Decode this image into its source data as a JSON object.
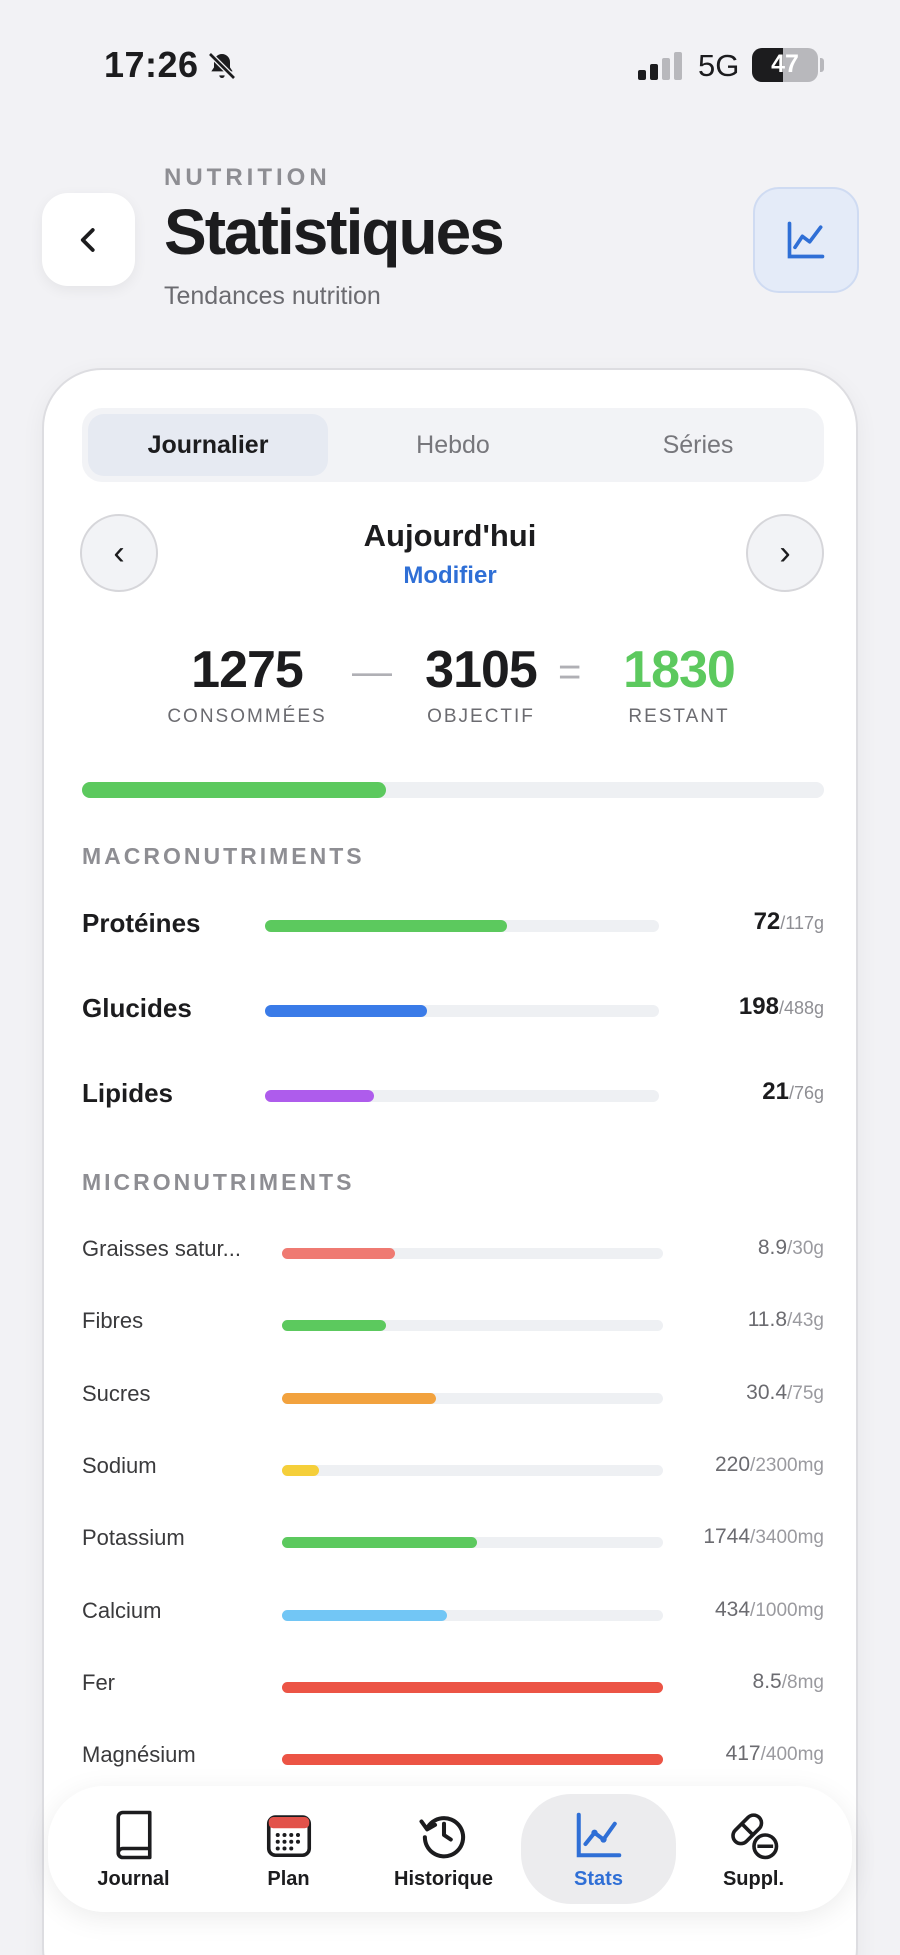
{
  "status_bar": {
    "time": "17:26",
    "network": "5G",
    "battery": "47"
  },
  "header": {
    "eyebrow": "NUTRITION",
    "title": "Statistiques",
    "subtitle": "Tendances nutrition"
  },
  "tabs": [
    "Journalier",
    "Hebdo",
    "Séries"
  ],
  "active_tab": "Journalier",
  "date": {
    "label": "Aujourd'hui",
    "edit": "Modifier",
    "prev": "‹",
    "next": "›"
  },
  "calories": {
    "consumed": "1275",
    "consumed_label": "CONSOMMÉES",
    "minus": "—",
    "goal": "3105",
    "goal_label": "OBJECTIF",
    "equals": "=",
    "remaining": "1830",
    "remaining_label": "RESTANT",
    "progress": 0.41
  },
  "macros": {
    "title": "MACRONUTRIMENTS",
    "items": [
      {
        "name": "Protéines",
        "value": "72",
        "goal": "/117g",
        "progress": 0.615,
        "color": "#5cc95e"
      },
      {
        "name": "Glucides",
        "value": "198",
        "goal": "/488g",
        "progress": 0.41,
        "color": "#3a7be8"
      },
      {
        "name": "Lipides",
        "value": "21",
        "goal": "/76g",
        "progress": 0.276,
        "color": "#ae5cec"
      }
    ]
  },
  "micros": {
    "title": "MICRONUTRIMENTS",
    "items": [
      {
        "name": "Graisses satur...",
        "value": "8.9",
        "goal": "/30g",
        "progress": 0.297,
        "color": "#ef7a72"
      },
      {
        "name": "Fibres",
        "value": "11.8",
        "goal": "/43g",
        "progress": 0.274,
        "color": "#5cc95e"
      },
      {
        "name": "Sucres",
        "value": "30.4",
        "goal": "/75g",
        "progress": 0.405,
        "color": "#f2a23e"
      },
      {
        "name": "Sodium",
        "value": "220",
        "goal": "/2300mg",
        "progress": 0.096,
        "color": "#f5cf3a"
      },
      {
        "name": "Potassium",
        "value": "1744",
        "goal": "/3400mg",
        "progress": 0.513,
        "color": "#5cc95e"
      },
      {
        "name": "Calcium",
        "value": "434",
        "goal": "/1000mg",
        "progress": 0.434,
        "color": "#72c6f5"
      },
      {
        "name": "Fer",
        "value": "8.5",
        "goal": "/8mg",
        "progress": 1.0,
        "color": "#ec5445"
      },
      {
        "name": "Magnésium",
        "value": "417",
        "goal": "/400mg",
        "progress": 1.0,
        "color": "#ec5445"
      }
    ]
  },
  "tab_bar": {
    "items": [
      {
        "label": "Journal",
        "icon": "book-icon"
      },
      {
        "label": "Plan",
        "icon": "calendar-icon"
      },
      {
        "label": "Historique",
        "icon": "history-icon"
      },
      {
        "label": "Stats",
        "icon": "chart-line-icon"
      },
      {
        "label": "Suppl.",
        "icon": "pill-icon"
      }
    ],
    "active": "Stats"
  },
  "colors": {
    "accent": "#2f6fd6",
    "remaining": "#5cc95e",
    "text": "#1c1c1e",
    "muted": "#8e8e93"
  }
}
